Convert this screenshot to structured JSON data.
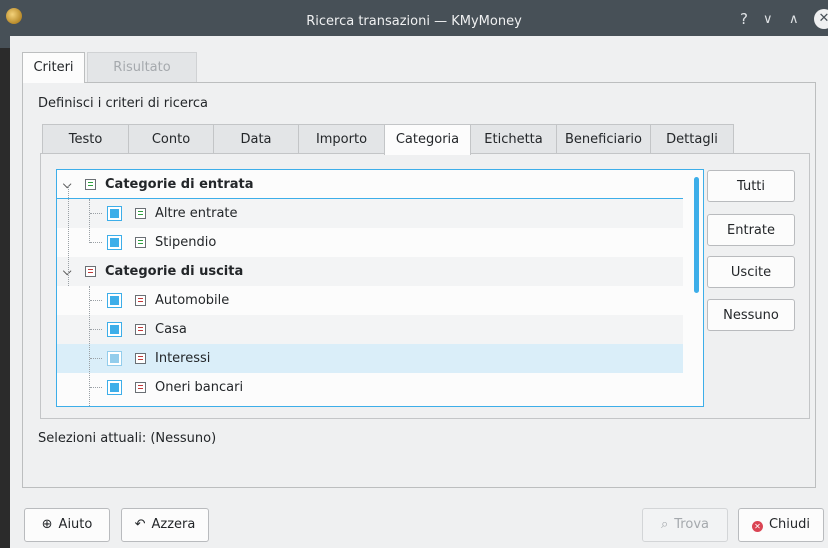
{
  "window": {
    "title": "Ricerca transazioni — KMyMoney",
    "help_glyph": "?",
    "minimize_glyph": "∨",
    "maximize_glyph": "∧",
    "close_glyph": "✕"
  },
  "outer_tabs": [
    {
      "label": "Criteri",
      "active": true
    },
    {
      "label": "Risultato",
      "active": false
    }
  ],
  "section_label": "Definisci i criteri di ricerca",
  "inner_tabs": [
    {
      "label": "Testo"
    },
    {
      "label": "Conto"
    },
    {
      "label": "Data"
    },
    {
      "label": "Importo"
    },
    {
      "label": "Categoria",
      "active": true
    },
    {
      "label": "Etichetta"
    },
    {
      "label": "Beneficiario"
    },
    {
      "label": "Dettagli"
    }
  ],
  "tree": {
    "groups": [
      {
        "label": "Categorie di entrata",
        "icon": "income-category-icon",
        "expanded": true,
        "items": [
          {
            "label": "Altre entrate",
            "checked": true
          },
          {
            "label": "Stipendio",
            "checked": true
          }
        ]
      },
      {
        "label": "Categorie di uscita",
        "icon": "expense-category-icon",
        "expanded": true,
        "items": [
          {
            "label": "Automobile",
            "checked": true
          },
          {
            "label": "Casa",
            "checked": true
          },
          {
            "label": "Interessi",
            "checked": true,
            "selected": true
          },
          {
            "label": "Oneri bancari",
            "checked": true
          }
        ]
      }
    ]
  },
  "side_buttons": {
    "all": "Tutti",
    "income": "Entrate",
    "expense": "Uscite",
    "none": "Nessuno"
  },
  "status": "Selezioni attuali: (Nessuno)",
  "footer": {
    "help": "Aiuto",
    "reset": "Azzera",
    "find": "Trova",
    "close": "Chiudi"
  },
  "colors": {
    "accent": "#3daee9",
    "titlebar": "#475057",
    "selection": "#daeef9",
    "close_red": "#da4453"
  }
}
